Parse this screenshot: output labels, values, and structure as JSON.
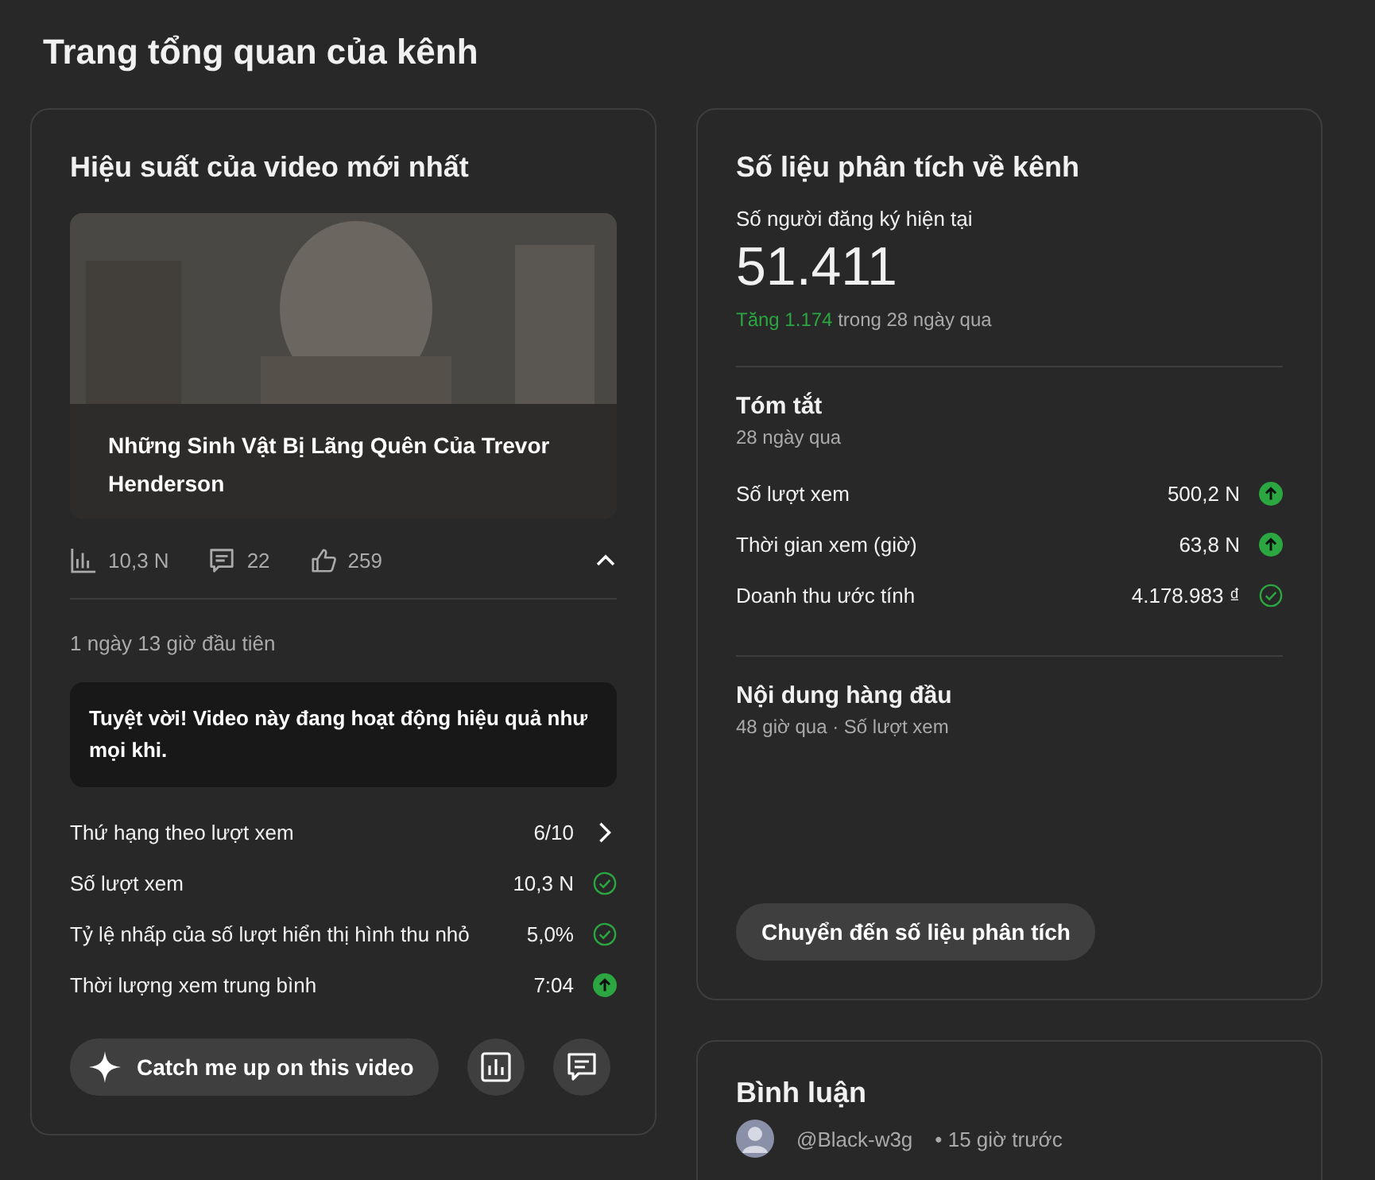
{
  "page_title": "Trang tổng quan của kênh",
  "latest_video": {
    "title": "Hiệu suất của video mới nhất",
    "video": {
      "kind": "picture",
      "title": "Những Sinh Vật Bị Lãng Quên Của Trevor Henderson"
    },
    "stats": [
      {
        "kind": "views",
        "value": "10,3 N"
      },
      {
        "kind": "comments",
        "value": "22"
      },
      {
        "kind": "likes",
        "value": "259"
      }
    ],
    "expanded": true,
    "period": "1 ngày 13 giờ đầu tiên",
    "message": "Tuyệt vời! Video này đang hoạt động hiệu quả như mọi khi.",
    "metrics": [
      {
        "label": "Thứ hạng theo lượt xem",
        "value": "6/10",
        "kind": "chevron"
      },
      {
        "label": "Số lượt xem",
        "value": "10,3 N",
        "kind": "check"
      },
      {
        "label": "Tỷ lệ nhấp của số lượt hiển thị hình thu nhỏ",
        "value": "5,0%",
        "kind": "check"
      },
      {
        "label": "Thời lượng xem trung bình",
        "value": "7:04",
        "kind": "up"
      }
    ],
    "catch_up_button": "Catch me up on this video"
  },
  "analytics": {
    "title": "Số liệu phân tích về kênh",
    "subscribers_label": "Số người đăng ký hiện tại",
    "subscribers": "51.411",
    "change": "Tăng 1.174",
    "change_period": "trong 28 ngày qua",
    "summary_title": "Tóm tắt",
    "summary_period": "28 ngày qua",
    "summary": [
      {
        "label": "Số lượt xem",
        "value": "500,2 N",
        "kind": "up"
      },
      {
        "label": "Thời gian xem (giờ)",
        "value": "63,8 N",
        "kind": "up"
      },
      {
        "label": "Doanh thu ước tính",
        "value": "4.178.983 ₫",
        "kind": "check"
      }
    ],
    "top_title": "Nội dung hàng đầu",
    "top_period": "48 giờ qua · Số lượt xem",
    "button": "Chuyển đến số liệu phân tích"
  },
  "comments": {
    "title": "Bình luận",
    "items": [
      {
        "author": "@Black-w3g",
        "time": "• 15 giờ trước"
      }
    ]
  }
}
